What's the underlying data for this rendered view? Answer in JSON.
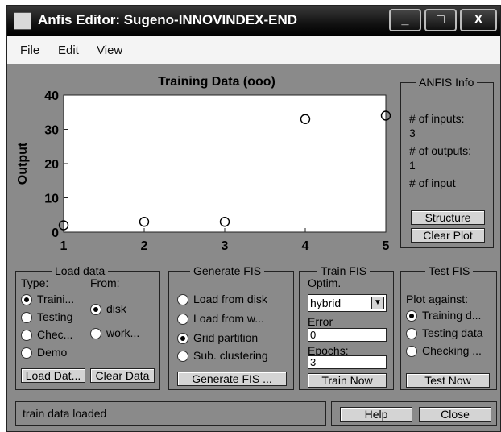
{
  "window": {
    "title": "Anfis Editor: Sugeno-INNOVINDEX-END",
    "controls": [
      "_",
      "□",
      "X"
    ]
  },
  "menu": [
    "File",
    "Edit",
    "View"
  ],
  "chart_data": {
    "type": "scatter",
    "title": "Training Data (ooo)",
    "xlabel": "",
    "ylabel": "Output",
    "xlim": [
      1,
      5
    ],
    "ylim": [
      0,
      40
    ],
    "xticks": [
      "1",
      "2",
      "3",
      "4",
      "5"
    ],
    "yticks": [
      "0",
      "10",
      "20",
      "30",
      "40"
    ],
    "points": [
      {
        "x": 1,
        "y": 2
      },
      {
        "x": 2,
        "y": 3
      },
      {
        "x": 3,
        "y": 3
      },
      {
        "x": 4,
        "y": 33
      },
      {
        "x": 5,
        "y": 34
      }
    ]
  },
  "anfis_info": {
    "title": "ANFIS Info",
    "lines": [
      "# of inputs:",
      "3",
      "# of outputs:",
      "1",
      "# of input"
    ],
    "structure_button": "Structure",
    "clear_plot_button": "Clear Plot"
  },
  "load_data": {
    "title": "Load data",
    "type_label": "Type:",
    "from_label": "From:",
    "types": [
      "Traini...",
      "Testing",
      "Chec...",
      "Demo"
    ],
    "selected_type": "Traini...",
    "sources": [
      "disk",
      "work..."
    ],
    "selected_source": "disk",
    "load_button": "Load Dat...",
    "clear_button": "Clear Data"
  },
  "generate_fis": {
    "title": "Generate FIS",
    "options": [
      "Load from disk",
      "Load from w...",
      "Grid partition",
      "Sub. clustering"
    ],
    "selected": "Grid partition",
    "button": "Generate FIS ..."
  },
  "train_fis": {
    "title": "Train FIS",
    "optim_label": "Optim.",
    "method": "hybrid",
    "error_label": "Error",
    "error_value": "0",
    "epochs_label": "Epochs:",
    "epochs_value": "3",
    "button": "Train Now"
  },
  "test_fis": {
    "title": "Test FIS",
    "plot_against_label": "Plot against:",
    "options": [
      "Training d...",
      "Testing data",
      "Checking ..."
    ],
    "selected": "Training d...",
    "button": "Test Now"
  },
  "status": {
    "message": "train data loaded"
  },
  "footer": {
    "help_button": "Help",
    "close_button": "Close"
  }
}
